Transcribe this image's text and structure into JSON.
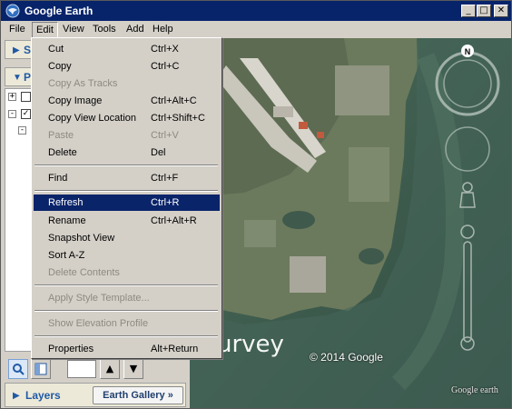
{
  "window": {
    "title": "Google Earth",
    "min_symbol": "_",
    "max_symbol": "□",
    "close_symbol": "✕"
  },
  "menubar": [
    "File",
    "Edit",
    "View",
    "Tools",
    "Add",
    "Help"
  ],
  "panels": {
    "search_label": "S",
    "places_label": "P",
    "layers_label": "Layers",
    "gallery_label": "Earth Gallery »"
  },
  "toolbar": {
    "search_icon": "search-icon",
    "up_symbol": "▲",
    "down_symbol": "▼"
  },
  "tree": {
    "expand1": "+",
    "expand2": "-",
    "check2": "✓"
  },
  "edit_menu": [
    {
      "label": "Cut",
      "shortcut": "Ctrl+X",
      "enabled": true
    },
    {
      "label": "Copy",
      "shortcut": "Ctrl+C",
      "enabled": true
    },
    {
      "label": "Copy As Tracks",
      "shortcut": "",
      "enabled": false
    },
    {
      "label": "Copy Image",
      "shortcut": "Ctrl+Alt+C",
      "enabled": true
    },
    {
      "label": "Copy View Location",
      "shortcut": "Ctrl+Shift+C",
      "enabled": true
    },
    {
      "label": "Paste",
      "shortcut": "Ctrl+V",
      "enabled": false
    },
    {
      "label": "Delete",
      "shortcut": "Del",
      "enabled": true
    },
    {
      "label": "Find",
      "shortcut": "Ctrl+F",
      "enabled": true
    },
    {
      "label": "Refresh",
      "shortcut": "Ctrl+R",
      "enabled": true,
      "highlighted": true
    },
    {
      "label": "Rename",
      "shortcut": "Ctrl+Alt+R",
      "enabled": true
    },
    {
      "label": "Snapshot View",
      "shortcut": "",
      "enabled": true
    },
    {
      "label": "Sort A-Z",
      "shortcut": "",
      "enabled": true
    },
    {
      "label": "Delete Contents",
      "shortcut": "",
      "enabled": false
    },
    {
      "label": "Apply Style Template...",
      "shortcut": "",
      "enabled": false
    },
    {
      "label": "Show Elevation Profile",
      "shortcut": "",
      "enabled": false
    },
    {
      "label": "Properties",
      "shortcut": "Alt+Return",
      "enabled": true
    }
  ],
  "map": {
    "copyright": "© 2014 Google",
    "watermark": "Google earth",
    "overlay_text": "urvey",
    "compass_north": "N"
  },
  "colors": {
    "titlebar": "#07246b",
    "highlight": "#0a246a",
    "panel_text": "#1f5aa6"
  }
}
